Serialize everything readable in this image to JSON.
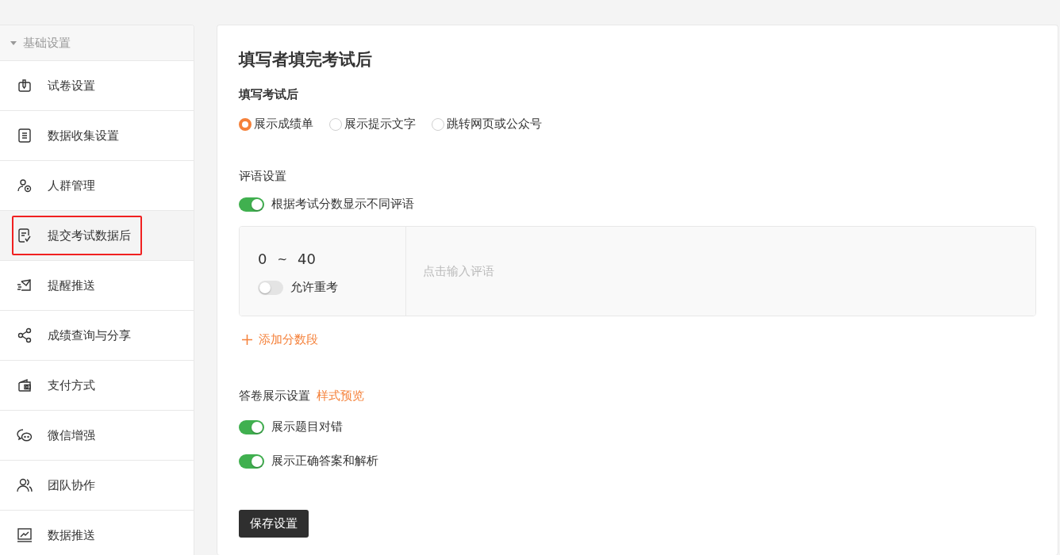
{
  "sidebar": {
    "group": {
      "label": "基础设置",
      "expanded": true
    },
    "items": [
      {
        "label": "试卷设置",
        "selected": false
      },
      {
        "label": "数据收集设置",
        "selected": false
      },
      {
        "label": "人群管理",
        "selected": false
      },
      {
        "label": "提交考试数据后",
        "selected": true
      },
      {
        "label": "提醒推送",
        "selected": false
      },
      {
        "label": "成绩查询与分享",
        "selected": false
      },
      {
        "label": "支付方式",
        "selected": false
      },
      {
        "label": "微信增强",
        "selected": false
      },
      {
        "label": "团队协作",
        "selected": false
      },
      {
        "label": "数据推送",
        "selected": false
      }
    ]
  },
  "main": {
    "title": "填写者填完考试后",
    "after_submit": {
      "label": "填写考试后",
      "options": [
        {
          "label": "展示成绩单",
          "selected": true
        },
        {
          "label": "展示提示文字",
          "selected": false
        },
        {
          "label": "跳转网页或公众号",
          "selected": false
        }
      ]
    },
    "comment": {
      "label": "评语设置",
      "toggle": {
        "label": "根据考试分数显示不同评语",
        "on": true
      },
      "ranges": [
        {
          "min": "0",
          "separator": "~",
          "max": "40",
          "retake": {
            "label": "允许重考",
            "on": false
          },
          "placeholder": "点击输入评语"
        }
      ],
      "add_label": "添加分数段"
    },
    "answer": {
      "label": "答卷展示设置",
      "preview_link": "样式预览",
      "toggles": [
        {
          "label": "展示题目对错",
          "on": true
        },
        {
          "label": "展示正确答案和解析",
          "on": true
        }
      ]
    },
    "save_button": "保存设置"
  }
}
